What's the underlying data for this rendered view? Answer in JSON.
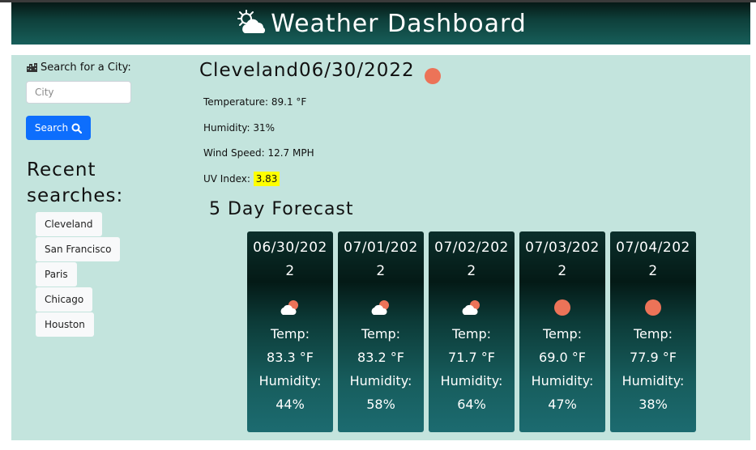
{
  "header": {
    "title": "Weather Dashboard",
    "logo_icon": "sun-cloud-icon"
  },
  "search": {
    "label": "Search for a City:",
    "placeholder": "City",
    "button_label": "Search",
    "recent_title": "Recent searches:",
    "recent": [
      "Cleveland",
      "San Francisco",
      "Paris",
      "Chicago",
      "Houston"
    ]
  },
  "current": {
    "city": "Cleveland",
    "date": "06/30/2022",
    "temperature": "Temperature: 89.1 °F",
    "humidity": "Humidity: 31%",
    "wind": "Wind Speed: 12.7 MPH",
    "uv_label": "UV Index:",
    "uv_value": "3.83",
    "uv_color": "#ffff00",
    "icon": "sun-icon"
  },
  "forecast": {
    "title": "5 Day Forecast",
    "days": [
      {
        "date": "06/30/2022",
        "icon": "partly-cloudy-icon",
        "temp_label": "Temp:",
        "temp": "83.3 °F",
        "humidity_label": "Humidity:",
        "humidity": "44%"
      },
      {
        "date": "07/01/2022",
        "icon": "partly-cloudy-icon",
        "temp_label": "Temp:",
        "temp": "83.2 °F",
        "humidity_label": "Humidity:",
        "humidity": "58%"
      },
      {
        "date": "07/02/2022",
        "icon": "partly-cloudy-icon",
        "temp_label": "Temp:",
        "temp": "71.7 °F",
        "humidity_label": "Humidity:",
        "humidity": "64%"
      },
      {
        "date": "07/03/2022",
        "icon": "sun-icon",
        "temp_label": "Temp:",
        "temp": "69.0 °F",
        "humidity_label": "Humidity:",
        "humidity": "47%"
      },
      {
        "date": "07/04/2022",
        "icon": "sun-icon",
        "temp_label": "Temp:",
        "temp": "77.9 °F",
        "humidity_label": "Humidity:",
        "humidity": "38%"
      }
    ]
  },
  "colors": {
    "header": "#0e3f3a",
    "main_bg": "#c3e4dd",
    "accent": "#0d6efd",
    "sun": "#ec7358"
  }
}
